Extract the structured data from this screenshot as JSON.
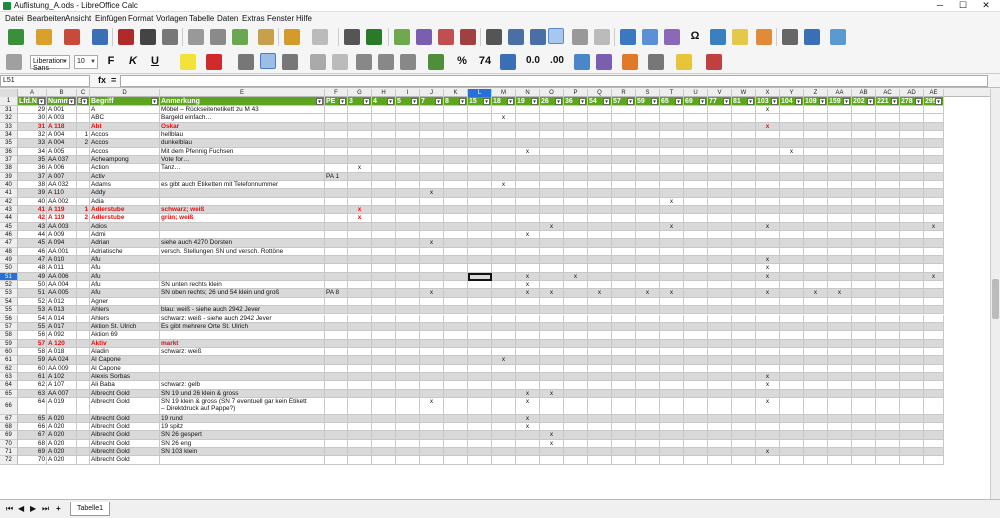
{
  "window": {
    "title": "Auflistung_A.ods - LibreOffice Calc",
    "minimize": "─",
    "maximize": "☐",
    "close": "✕"
  },
  "menu": [
    "Datei",
    "Bearbeiten",
    "Ansicht",
    "Einfügen",
    "Format",
    "Vorlagen",
    "Tabelle",
    "Daten",
    "Extras",
    "Fenster",
    "Hilfe"
  ],
  "toolbar": {
    "font_name": "Liberation Sans",
    "font_size": "10",
    "bold": "F",
    "italic": "K",
    "underline": "U",
    "percent": "%",
    "number": "74",
    "decimal_add": "0.0",
    "decimal_del": ".00",
    "styles_icon": "Σ",
    "omega": "Ω"
  },
  "formula_bar": {
    "name_box": "L51",
    "fx": "fx",
    "sum": "Σ",
    "eq": "=",
    "value": ""
  },
  "columns": [
    "A",
    "B",
    "C",
    "D",
    "E",
    "F",
    "G",
    "H",
    "I",
    "J",
    "K",
    "L",
    "M",
    "N",
    "O",
    "P",
    "Q",
    "R",
    "S",
    "T",
    "U",
    "V",
    "W",
    "X",
    "Y",
    "Z",
    "AA",
    "AB",
    "AC",
    "AD",
    "AE"
  ],
  "selected_col": "L",
  "header_row": {
    "num": "1",
    "cells": [
      "Lfd.N",
      "Numm",
      "Be",
      "Begriff",
      "Anmerkung",
      "PE",
      "3",
      "4",
      "5",
      "7",
      "8",
      "15",
      "18",
      "19",
      "26",
      "36",
      "54",
      "57",
      "59",
      "65",
      "69",
      "77",
      "81",
      "103",
      "104",
      "109",
      "159",
      "202",
      "221",
      "278",
      "295"
    ]
  },
  "rows": [
    {
      "n": "31",
      "a": "29",
      "b": "A 001",
      "c": "",
      "d": "A",
      "e": "Möbel – Rückseitenetikett zu M 43",
      "f": "",
      "m": {
        "X": "x"
      }
    },
    {
      "n": "32",
      "a": "30",
      "b": "A 003",
      "c": "",
      "d": "ABC",
      "e": "Bargeld einfach…",
      "f": "",
      "m": {
        "M": "x"
      }
    },
    {
      "n": "33",
      "a": "31",
      "b": "A 118",
      "c": "",
      "d": "Abt",
      "e": "Oskar",
      "f": "",
      "m": {
        "X": "x"
      },
      "red": true,
      "shade": true
    },
    {
      "n": "34",
      "a": "32",
      "b": "A 004",
      "c": "1",
      "d": "Accos",
      "e": "hellblau",
      "f": "",
      "m": {}
    },
    {
      "n": "35",
      "a": "33",
      "b": "A 004",
      "c": "2",
      "d": "Accos",
      "e": "dunkelblau",
      "f": "",
      "m": {},
      "shade": true
    },
    {
      "n": "36",
      "a": "34",
      "b": "A 005",
      "c": "",
      "d": "Accos",
      "e": "Mit dem Pfennig Fuchsen",
      "f": "",
      "m": {
        "N": "x",
        "Y": "x"
      }
    },
    {
      "n": "37",
      "a": "35",
      "b": "AA 037",
      "c": "",
      "d": "Acheampong",
      "e": "Vote for…",
      "f": "",
      "m": {},
      "shade": true
    },
    {
      "n": "38",
      "a": "36",
      "b": "A 006",
      "c": "",
      "d": "Action",
      "e": "Tanz…",
      "f": "",
      "m": {
        "G": "x"
      }
    },
    {
      "n": "39",
      "a": "37",
      "b": "A 007",
      "c": "",
      "d": "Activ",
      "e": "",
      "f": "PA 1",
      "m": {},
      "shade": true
    },
    {
      "n": "40",
      "a": "38",
      "b": "AA 032",
      "c": "",
      "d": "Adams",
      "e": "es gibt auch Etiketten mit Telefonnummer",
      "f": "",
      "m": {
        "M": "x"
      }
    },
    {
      "n": "41",
      "a": "39",
      "b": "A 110",
      "c": "",
      "d": "Addy",
      "e": "",
      "f": "",
      "m": {
        "J": "x"
      },
      "shade": true
    },
    {
      "n": "42",
      "a": "40",
      "b": "AA 002",
      "c": "",
      "d": "Adia",
      "e": "",
      "f": "",
      "m": {
        "T": "x"
      }
    },
    {
      "n": "43",
      "a": "41",
      "b": "A 119",
      "c": "1",
      "d": "Adlerstube",
      "e": "schwarz; weiß",
      "f": "",
      "m": {
        "G": "x"
      },
      "red": true,
      "shade": true
    },
    {
      "n": "44",
      "a": "42",
      "b": "A 119",
      "c": "2",
      "d": "Adlerstube",
      "e": "grün; weiß",
      "f": "",
      "m": {
        "G": "x"
      },
      "red": true
    },
    {
      "n": "45",
      "a": "43",
      "b": "AA 003",
      "c": "",
      "d": "Adios",
      "e": "",
      "f": "",
      "m": {
        "O": "x",
        "T": "x",
        "X": "x",
        "AE": "x"
      },
      "shade": true
    },
    {
      "n": "46",
      "a": "44",
      "b": "A 009",
      "c": "",
      "d": "Admi",
      "e": "",
      "f": "",
      "m": {
        "N": "x"
      }
    },
    {
      "n": "47",
      "a": "45",
      "b": "A 094",
      "c": "",
      "d": "Adrian",
      "e": "siehe auch 4270 Dorsten",
      "f": "",
      "m": {
        "J": "x"
      },
      "shade": true
    },
    {
      "n": "48",
      "a": "46",
      "b": "AA 001",
      "c": "",
      "d": "Adriatische",
      "e": "versch. Stellungen SN und versch. Rottöne",
      "f": "",
      "m": {}
    },
    {
      "n": "49",
      "a": "47",
      "b": "A 010",
      "c": "",
      "d": "Afu",
      "e": "",
      "f": "",
      "m": {
        "X": "x"
      },
      "shade": true
    },
    {
      "n": "50",
      "a": "48",
      "b": "A 011",
      "c": "",
      "d": "Afu",
      "e": "",
      "f": "",
      "m": {
        "X": "x"
      }
    },
    {
      "n": "51",
      "a": "49",
      "b": "AA 006",
      "c": "",
      "d": "Afu",
      "e": "",
      "f": "",
      "m": {
        "N": "x",
        "P": "x",
        "X": "x",
        "AE": "x"
      },
      "shade": true,
      "active": true
    },
    {
      "n": "52",
      "a": "50",
      "b": "AA 004",
      "c": "",
      "d": "Afu",
      "e": "SN unten rechts klein",
      "f": "",
      "m": {
        "N": "x"
      }
    },
    {
      "n": "53",
      "a": "51",
      "b": "AA 005",
      "c": "",
      "d": "Afu",
      "e": "SN oben rechts; 26 und 54 klein und groß",
      "f": "PA 8",
      "m": {
        "J": "x",
        "N": "x",
        "O": "x",
        "Q": "x",
        "S": "x",
        "T": "x",
        "X": "x",
        "Z": "x",
        "AA": "x"
      },
      "shade": true
    },
    {
      "n": "54",
      "a": "52",
      "b": "A 012",
      "c": "",
      "d": "Agner",
      "e": "",
      "f": "",
      "m": {}
    },
    {
      "n": "55",
      "a": "53",
      "b": "A 013",
      "c": "",
      "d": "Ahlers",
      "e": "blau: weiß - siehe auch 2942 Jever",
      "f": "",
      "m": {},
      "shade": true
    },
    {
      "n": "56",
      "a": "54",
      "b": "A 014",
      "c": "",
      "d": "Ahlers",
      "e": "schwarz: weiß - siehe auch 2942 Jever",
      "f": "",
      "m": {}
    },
    {
      "n": "57",
      "a": "55",
      "b": "A 017",
      "c": "",
      "d": "Aktion St. Ulrich",
      "e": "Es gibt mehrere Orte St. Ulrich",
      "f": "",
      "m": {},
      "shade": true
    },
    {
      "n": "58",
      "a": "56",
      "b": "A 092",
      "c": "",
      "d": "Aktion 69",
      "e": "",
      "f": "",
      "m": {}
    },
    {
      "n": "59",
      "a": "57",
      "b": "A 120",
      "c": "",
      "d": "Aktiv",
      "e": "markt",
      "f": "",
      "m": {},
      "red": true,
      "shade": true
    },
    {
      "n": "60",
      "a": "58",
      "b": "A 018",
      "c": "",
      "d": "Aladin",
      "e": "schwarz: weiß",
      "f": "",
      "m": {}
    },
    {
      "n": "61",
      "a": "59",
      "b": "AA 024",
      "c": "",
      "d": "Al Capone",
      "e": "",
      "f": "",
      "m": {
        "M": "x"
      },
      "shade": true
    },
    {
      "n": "62",
      "a": "60",
      "b": "AA 009",
      "c": "",
      "d": "Al Capone",
      "e": "",
      "f": "",
      "m": {}
    },
    {
      "n": "63",
      "a": "61",
      "b": "A 102",
      "c": "",
      "d": "Alexis Sorbas",
      "e": "",
      "f": "",
      "m": {
        "X": "x"
      },
      "shade": true
    },
    {
      "n": "64",
      "a": "62",
      "b": "A 107",
      "c": "",
      "d": "Ali Baba",
      "e": "schwarz: gelb",
      "f": "",
      "m": {
        "X": "x"
      }
    },
    {
      "n": "65",
      "a": "63",
      "b": "AA 007",
      "c": "",
      "d": "Albrecht Gold",
      "e": "SN 19 und 26 klein & gross",
      "f": "",
      "m": {
        "N": "x",
        "O": "x"
      },
      "shade": true
    },
    {
      "n": "66",
      "a": "64",
      "b": "A 019",
      "c": "",
      "d": "Albrecht Gold",
      "e": "SN 19 klein & gross (SN 7 eventuell gar kein Etikett",
      "e2": "– Direktdruck auf Pappe?)",
      "f": "",
      "m": {
        "J": "x",
        "N": "x",
        "X": "x"
      },
      "tall": true
    },
    {
      "n": "67",
      "a": "65",
      "b": "A 020",
      "c": "",
      "d": "Albrecht Gold",
      "e": "19 rund",
      "f": "",
      "m": {
        "N": "x"
      },
      "shade": true
    },
    {
      "n": "68",
      "a": "66",
      "b": "A 020",
      "c": "",
      "d": "Albrecht Gold",
      "e": "19 spitz",
      "f": "",
      "m": {
        "N": "x"
      }
    },
    {
      "n": "69",
      "a": "67",
      "b": "A 020",
      "c": "",
      "d": "Albrecht Gold",
      "e": "SN 26 gespert",
      "f": "",
      "m": {
        "O": "x"
      },
      "shade": true
    },
    {
      "n": "70",
      "a": "68",
      "b": "A 020",
      "c": "",
      "d": "Albrecht Gold",
      "e": "SN 26 eng",
      "f": "",
      "m": {
        "O": "x"
      }
    },
    {
      "n": "71",
      "a": "69",
      "b": "A 020",
      "c": "",
      "d": "Albrecht Gold",
      "e": "SN 103 klein",
      "f": "",
      "m": {
        "X": "x"
      },
      "shade": true
    },
    {
      "n": "72",
      "a": "70",
      "b": "A 020",
      "c": "",
      "d": "Albrecht Gold",
      "e": "",
      "f": "",
      "m": {}
    }
  ],
  "sheet_tab": "Tabelle1",
  "add_sheet": "+"
}
